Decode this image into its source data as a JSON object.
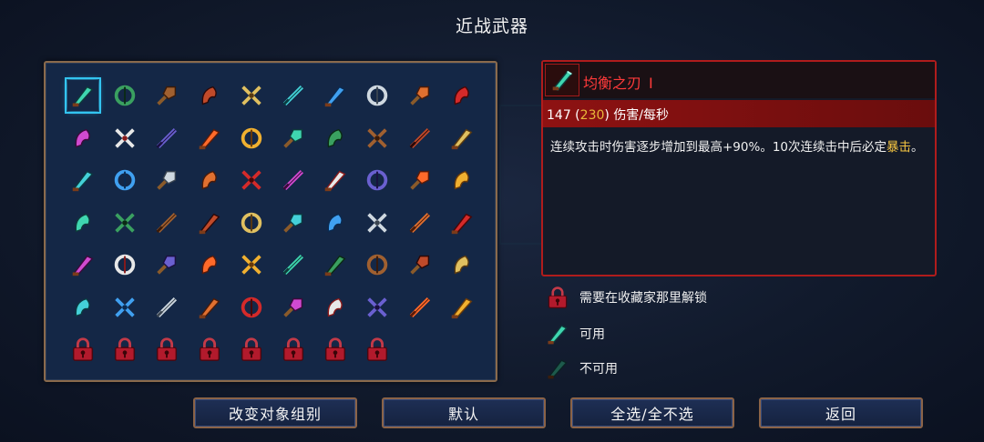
{
  "header": {
    "title": "近战武器"
  },
  "selected": {
    "name": "均衡之刃",
    "tier": "I",
    "dps": "147",
    "dps_bracket": "230",
    "dps_label": "伤害/每秒",
    "description_1": "连续攻击时伤害逐步增加到最高+90%。10次连续击中后必定",
    "keyword": "暴击",
    "description_2": "。"
  },
  "legend": {
    "locked": "需要在收藏家那里解锁",
    "available": "可用",
    "unavailable": "不可用"
  },
  "buttons": {
    "change_group": "改变对象组别",
    "default": "默认",
    "select_all": "全选/全不选",
    "back": "返回"
  },
  "grid": {
    "rows": [
      [
        "blade-icon",
        "flame-sword-icon",
        "cleaver-icon",
        "red-scythe-icon",
        "crossed-swords-icon",
        "frost-axe-icon",
        "dark-spear-icon",
        "twin-daggers-icon",
        "golden-broadsword-icon",
        "crossed-blades-icon"
      ],
      [
        "war-axe-icon",
        "golden-sword-icon",
        "ice-rapier-icon",
        "ice-trident-icon",
        "crossed-swords-icon",
        "sparkle-spear-icon",
        "purple-chakram-icon",
        "fire-shield-icon",
        "boot-icon",
        "boot-icon"
      ],
      [
        "red-claw-icon",
        "golden-claw-icon",
        "whip-icon",
        "purple-scythe-icon",
        "fire-fist-icon",
        "blue-sword-icon",
        "twin-swords-icon",
        "great-axe-icon",
        "purple-hook-icon",
        "frying-pan-icon"
      ],
      [
        "cards-icon",
        "purple-claw-icon",
        "lute-icon",
        "cane-icon",
        "meat-club-icon",
        "ice-staff-icon",
        "katana-icon",
        "tombstone-icon",
        "war-hammer-icon",
        "club-icon"
      ],
      [
        "crossed-axes-icon",
        "ice-lance-icon",
        "spear-icon",
        "bone-icon",
        "trident-icon",
        "hook-icon",
        "shark-icon",
        "crescent-icon",
        "broadsword-icon",
        "golden-dagger-icon"
      ],
      [
        "golden-scepter-icon",
        "baseball-bat-icon",
        "shadow-mask-icon",
        "pink-sword-icon",
        "rapier-icon",
        "greatsword-icon",
        "golden-whip-icon",
        "crossbow-icon",
        "drill-icon",
        "hammer-icon"
      ],
      [
        "lock-icon",
        "lock-icon",
        "lock-icon",
        "lock-icon",
        "lock-icon",
        "lock-icon",
        "lock-icon",
        "lock-icon"
      ]
    ],
    "selected_index": [
      0,
      0
    ]
  },
  "colors": {
    "accent": "#33c4f0",
    "danger": "#b01c1c",
    "panel_border": "#8a6a4c",
    "gold": "#e8b83a"
  }
}
